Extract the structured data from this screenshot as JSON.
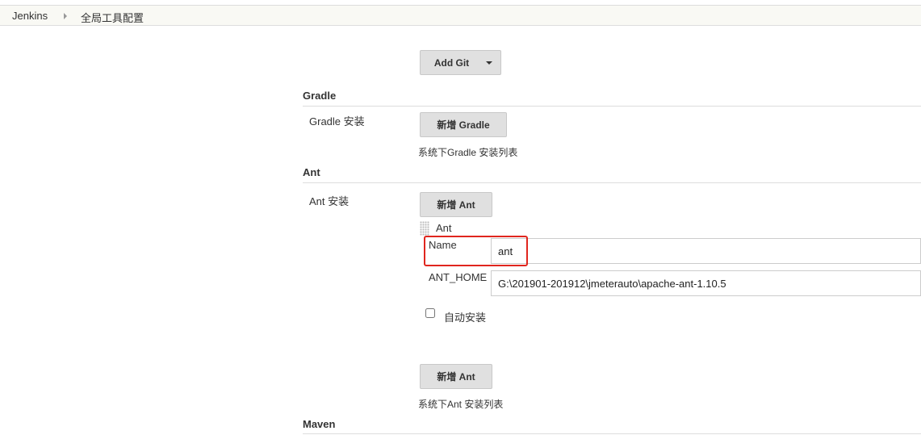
{
  "breadcrumb": {
    "home": "Jenkins",
    "page": "全局工具配置"
  },
  "git": {
    "add_button": "Add Git"
  },
  "gradle": {
    "section_title": "Gradle",
    "install_label": "Gradle 安装",
    "add_button": "新增 Gradle",
    "help_text": "系统下Gradle 安装列表"
  },
  "ant": {
    "section_title": "Ant",
    "install_label": "Ant 安装",
    "add_button_top": "新增 Ant",
    "item_header": "Ant",
    "name_label": "Name",
    "name_value": "ant",
    "home_label": "ANT_HOME",
    "home_value": "G:\\201901-201912\\jmeterauto\\apache-ant-1.10.5",
    "auto_install_label": "自动安装",
    "auto_install_checked": false,
    "add_button_bottom": "新增 Ant",
    "help_text": "系统下Ant 安装列表"
  },
  "maven": {
    "section_title": "Maven"
  },
  "colors": {
    "highlight": "#e0261e",
    "button_bg": "#e0e0e0",
    "breadcrumb_bg": "#f9f9f4"
  }
}
